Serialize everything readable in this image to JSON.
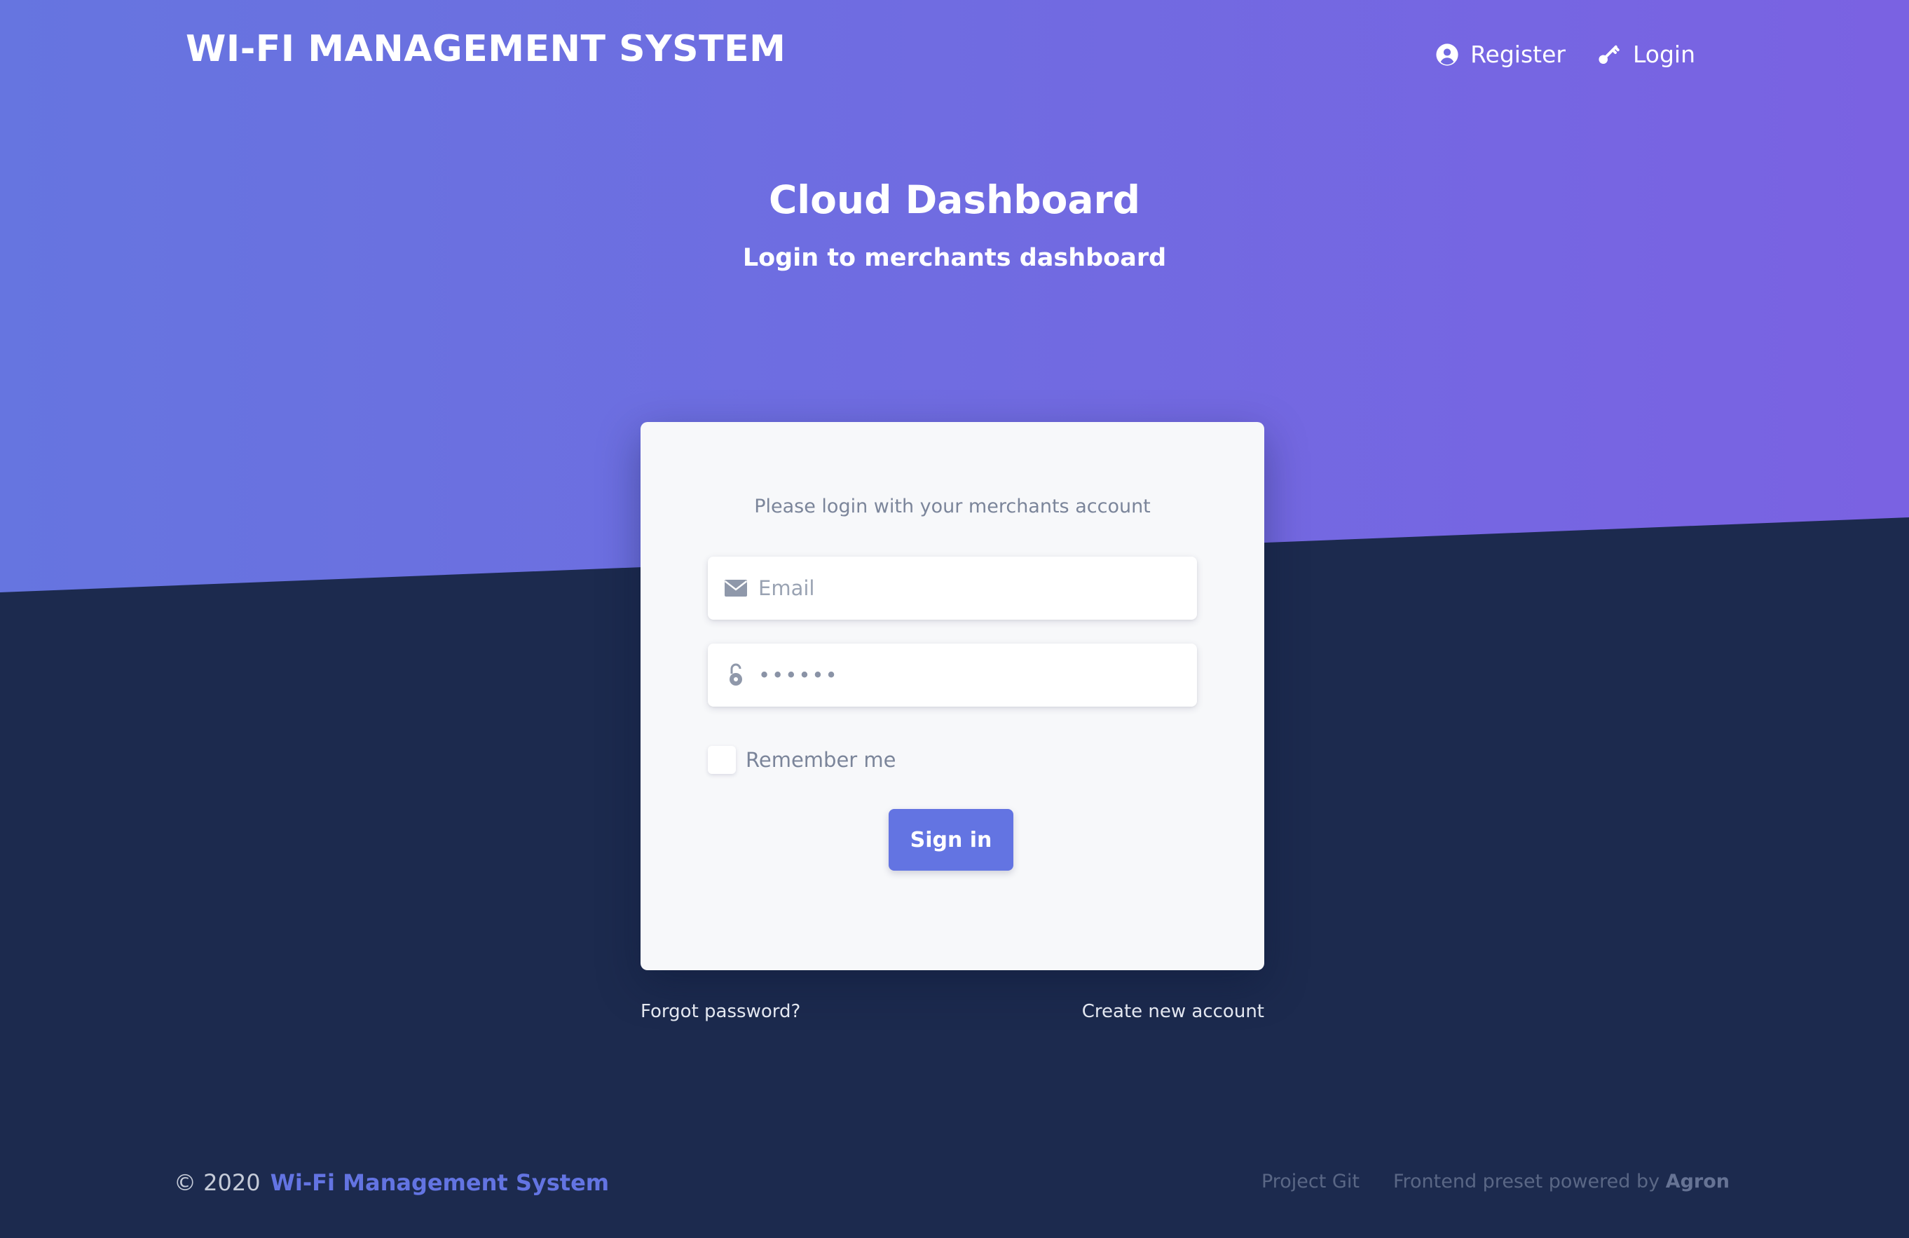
{
  "header": {
    "brand": "WI-FI MANAGEMENT SYSTEM",
    "nav": [
      {
        "label": "Register",
        "icon": "user-circle-icon"
      },
      {
        "label": "Login",
        "icon": "key-icon"
      }
    ]
  },
  "hero": {
    "title": "Cloud Dashboard",
    "subtitle": "Login to merchants dashboard"
  },
  "login_card": {
    "caption": "Please login with your merchants account",
    "email_placeholder": "Email",
    "password_value": "••••••",
    "remember_label": "Remember me",
    "signin_label": "Sign in"
  },
  "links": {
    "forgot": "Forgot password?",
    "create": "Create new account"
  },
  "footer": {
    "copyright": "© 2020",
    "brand_link": "Wi-Fi Management System",
    "project_git": "Project Git",
    "preset_prefix": "Frontend preset powered by",
    "preset_brand": "Agron"
  },
  "colors": {
    "gradient_start": "#6675e0",
    "gradient_end": "#7a62e2",
    "background_dark": "#1c2a4e",
    "accent": "#6374e2"
  }
}
